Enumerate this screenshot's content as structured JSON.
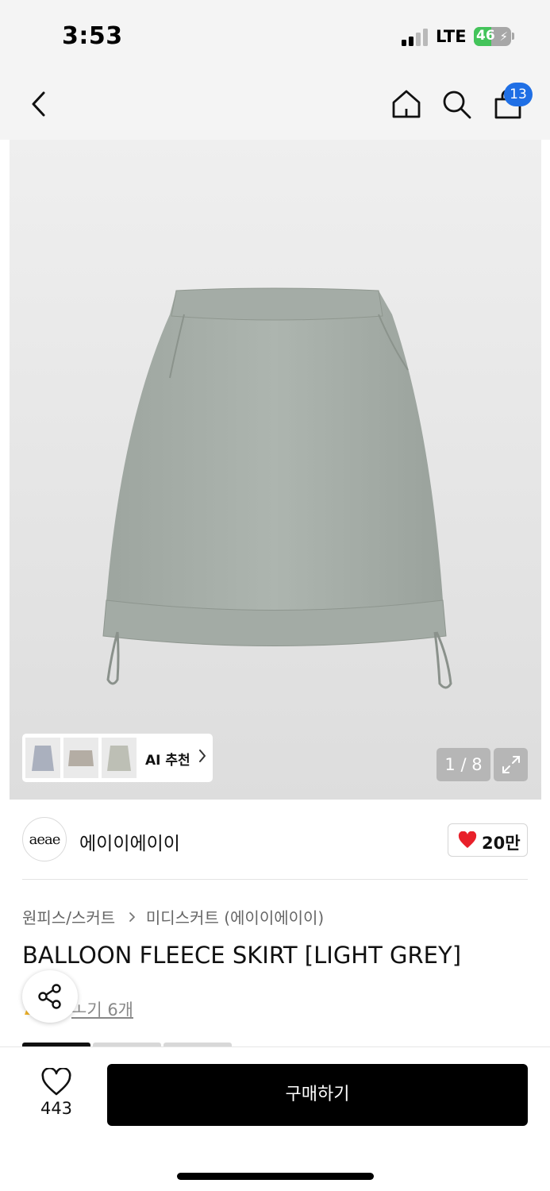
{
  "status_bar": {
    "time": "3:53",
    "network": "LTE",
    "battery_level": "46",
    "battery_fraction": 0.46,
    "signal_bars_active": 2,
    "signal_bars_total": 4
  },
  "header": {
    "back_icon": "chevron-left-icon",
    "home_icon": "home-icon",
    "search_icon": "search-icon",
    "cart_icon": "shopping-bag-icon",
    "cart_count": "13"
  },
  "gallery": {
    "ai_recommend_label": "AI 추천",
    "page_indicator": "1 / 8",
    "expand_icon": "expand-icon"
  },
  "brand": {
    "logo_text": "aeae",
    "name": "에이이에이이",
    "like_count": "20만"
  },
  "product": {
    "breadcrumb": [
      "원피스/스커트",
      "미디스커트 (에이이에이이)"
    ],
    "title": "BALLOON FLEECE SKIRT [LIGHT GREY]",
    "review_text": "후기 6개",
    "review_visible_text": "ㅗ기 6개"
  },
  "bottom_bar": {
    "wish_count": "443",
    "buy_label": "구매하기"
  },
  "colors": {
    "accent_blue": "#1f6fe5",
    "heart_red": "#e8202a",
    "battery_green": "#43c45a",
    "skirt_grey": "#a9b1ab"
  }
}
